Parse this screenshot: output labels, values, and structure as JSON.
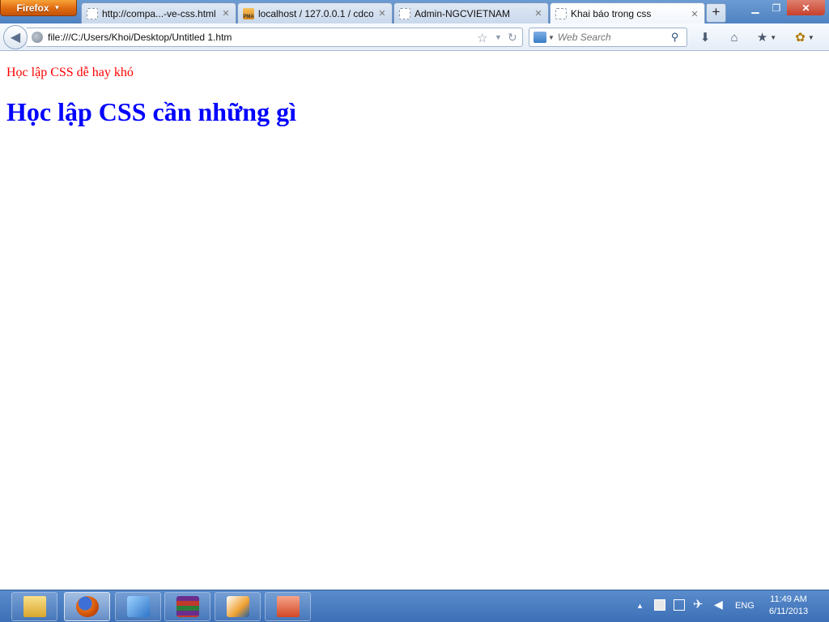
{
  "browser": {
    "menu_button_label": "Firefox",
    "tabs": [
      {
        "label": "http://compa...-ve-css.html",
        "active": false,
        "icon": "blank-page-icon"
      },
      {
        "label": "localhost / 127.0.0.1 / cdco...",
        "active": false,
        "icon": "phpmyadmin-icon"
      },
      {
        "label": "Admin-NGCVIETNAM",
        "active": false,
        "icon": "blank-page-icon"
      },
      {
        "label": "Khai báo trong css",
        "active": true,
        "icon": "blank-page-icon"
      }
    ],
    "url": "file:///C:/Users/Khoi/Desktop/Untitled 1.htm",
    "search_placeholder": "Web Search",
    "pma_icon_text": "PMA"
  },
  "page": {
    "paragraph": "Học lập CSS dễ hay khó",
    "heading": "Học lập CSS cần những gì"
  },
  "colors": {
    "paragraph_text": "#ff0000",
    "heading_text": "#0000ff",
    "firefox_button": "#e06a10",
    "taskbar": "#4a7dc0"
  },
  "taskbar": {
    "apps": [
      "file-explorer-icon",
      "firefox-icon",
      "app-icon",
      "winrar-icon",
      "app-icon",
      "powerpoint-icon"
    ],
    "language": "ENG",
    "time": "11:49 AM",
    "date": "6/11/2013"
  }
}
